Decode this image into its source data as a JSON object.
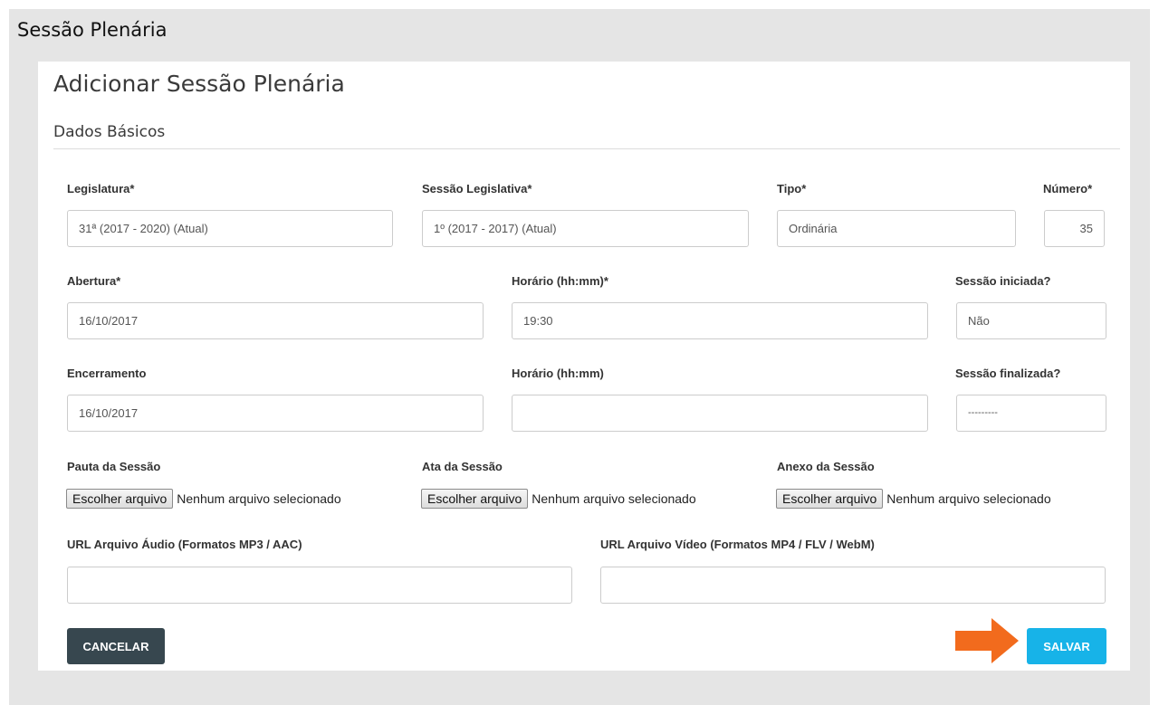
{
  "page": {
    "title": "Sessão Plenária"
  },
  "form": {
    "title": "Adicionar Sessão Plenária",
    "section": "Dados Básicos",
    "legislatura": {
      "label": "Legislatura*",
      "value": "31ª (2017 - 2020) (Atual)"
    },
    "sessao_legislativa": {
      "label": "Sessão Legislativa*",
      "value": "1º (2017 - 2017) (Atual)"
    },
    "tipo": {
      "label": "Tipo*",
      "value": "Ordinária"
    },
    "numero": {
      "label": "Número*",
      "value": "35"
    },
    "abertura": {
      "label": "Abertura*",
      "value": "16/10/2017"
    },
    "horario_abertura": {
      "label": "Horário (hh:mm)*",
      "value": "19:30"
    },
    "sessao_iniciada": {
      "label": "Sessão iniciada?",
      "value": "Não"
    },
    "encerramento": {
      "label": "Encerramento",
      "value": "16/10/2017"
    },
    "horario_encerramento": {
      "label": "Horário (hh:mm)",
      "value": ""
    },
    "sessao_finalizada": {
      "label": "Sessão finalizada?",
      "value": "---------"
    },
    "pauta": {
      "label": "Pauta da Sessão",
      "button": "Escolher arquivo",
      "status": "Nenhum arquivo selecionado"
    },
    "ata": {
      "label": "Ata da Sessão",
      "button": "Escolher arquivo",
      "status": "Nenhum arquivo selecionado"
    },
    "anexo": {
      "label": "Anexo da Sessão",
      "button": "Escolher arquivo",
      "status": "Nenhum arquivo selecionado"
    },
    "url_audio": {
      "label": "URL Arquivo Áudio (Formatos MP3 / AAC)",
      "value": ""
    },
    "url_video": {
      "label": "URL Arquivo Vídeo (Formatos MP4 / FLV / WebM)",
      "value": ""
    }
  },
  "actions": {
    "cancel": "CANCELAR",
    "save": "SALVAR"
  },
  "annotation": {
    "arrow_color": "#f26b1d",
    "icon": "arrow-right-icon"
  },
  "colors": {
    "cancel_bg": "#37474f",
    "save_bg": "#17b3e8",
    "frame_bg": "#e5e5e5"
  }
}
